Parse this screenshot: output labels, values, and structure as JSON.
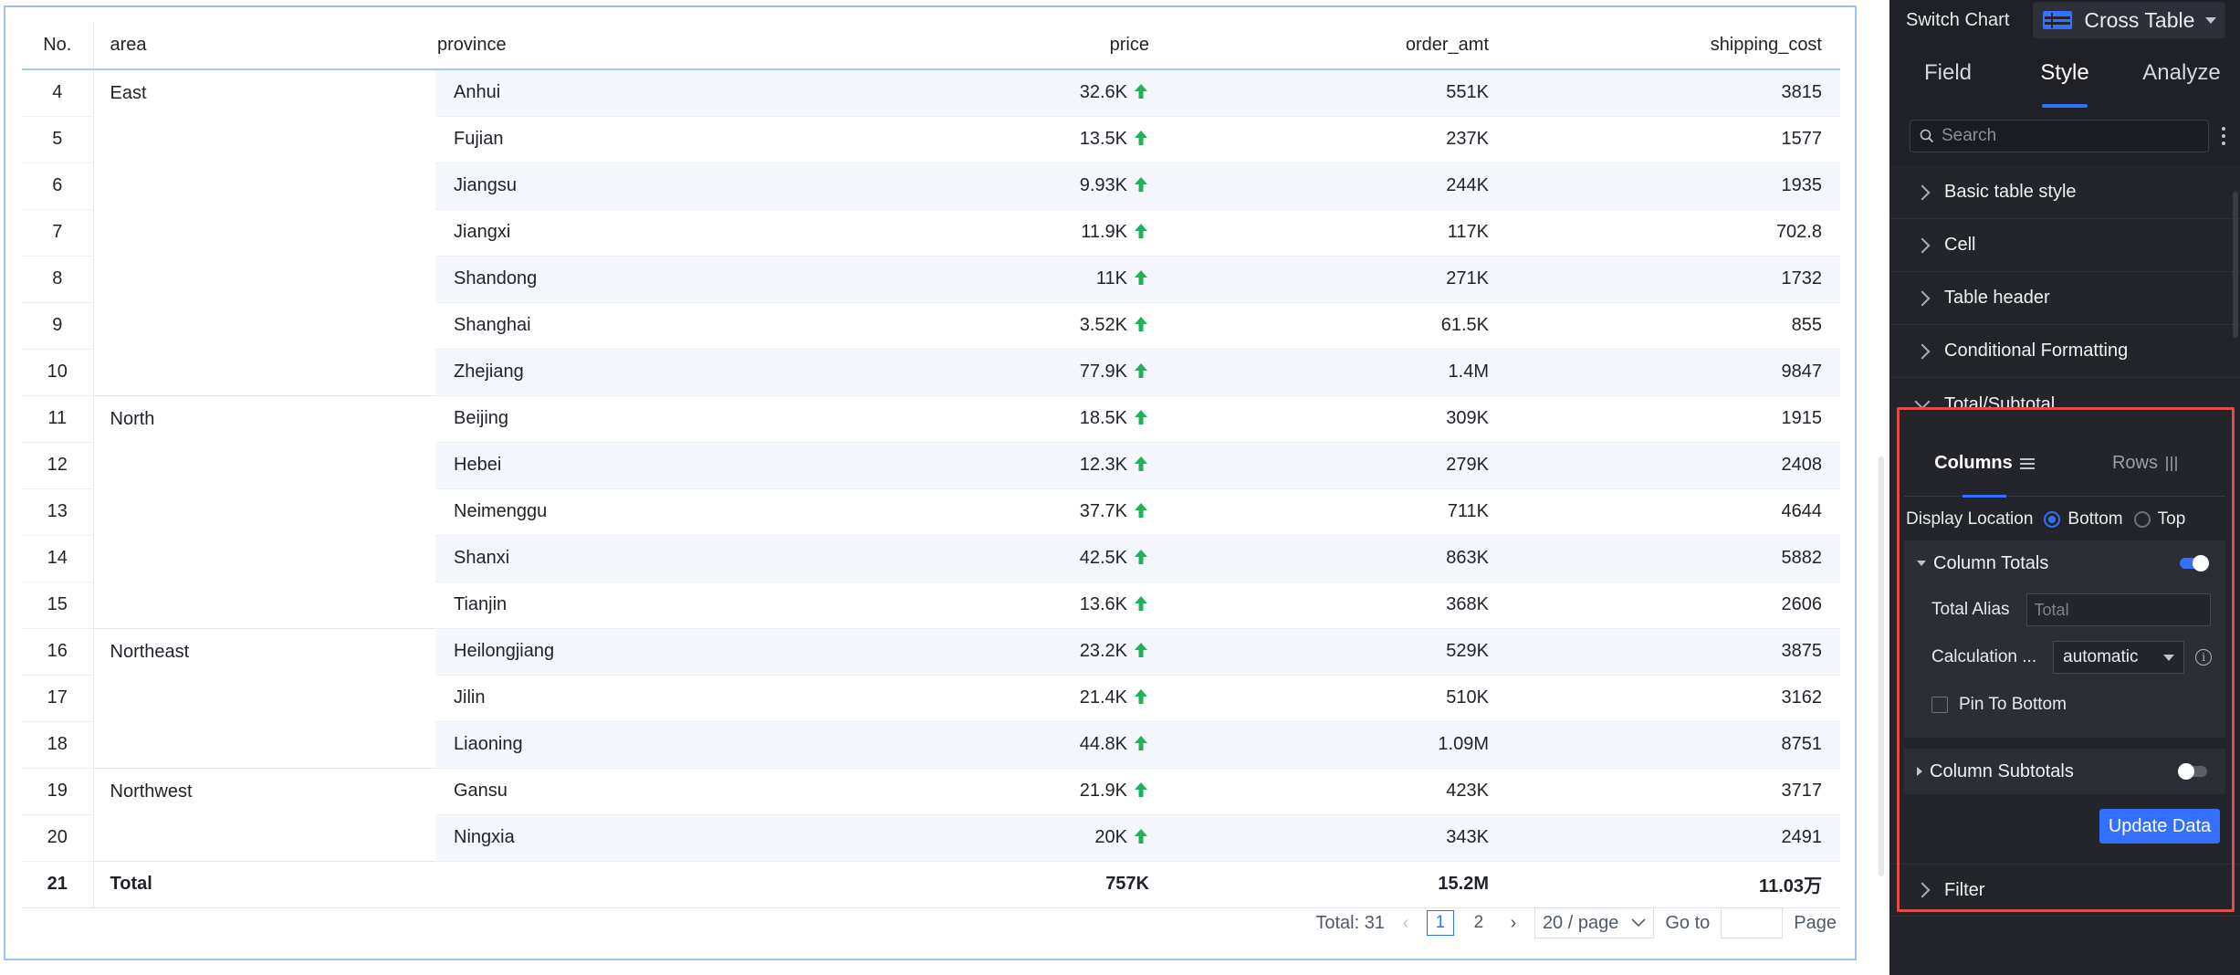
{
  "table": {
    "headers": [
      "No.",
      "area",
      "province",
      "price",
      "order_amt",
      "shipping_cost"
    ],
    "groups": [
      {
        "area": "East",
        "rows": [
          {
            "no": "4",
            "province": "Anhui",
            "price": "32.6K",
            "order_amt": "551K",
            "shipping_cost": "3815"
          },
          {
            "no": "5",
            "province": "Fujian",
            "price": "13.5K",
            "order_amt": "237K",
            "shipping_cost": "1577"
          },
          {
            "no": "6",
            "province": "Jiangsu",
            "price": "9.93K",
            "order_amt": "244K",
            "shipping_cost": "1935"
          },
          {
            "no": "7",
            "province": "Jiangxi",
            "price": "11.9K",
            "order_amt": "117K",
            "shipping_cost": "702.8"
          },
          {
            "no": "8",
            "province": "Shandong",
            "price": "11K",
            "order_amt": "271K",
            "shipping_cost": "1732"
          },
          {
            "no": "9",
            "province": "Shanghai",
            "price": "3.52K",
            "order_amt": "61.5K",
            "shipping_cost": "855"
          },
          {
            "no": "10",
            "province": "Zhejiang",
            "price": "77.9K",
            "order_amt": "1.4M",
            "shipping_cost": "9847"
          }
        ]
      },
      {
        "area": "North",
        "rows": [
          {
            "no": "11",
            "province": "Beijing",
            "price": "18.5K",
            "order_amt": "309K",
            "shipping_cost": "1915"
          },
          {
            "no": "12",
            "province": "Hebei",
            "price": "12.3K",
            "order_amt": "279K",
            "shipping_cost": "2408"
          },
          {
            "no": "13",
            "province": "Neimenggu",
            "price": "37.7K",
            "order_amt": "711K",
            "shipping_cost": "4644"
          },
          {
            "no": "14",
            "province": "Shanxi",
            "price": "42.5K",
            "order_amt": "863K",
            "shipping_cost": "5882"
          },
          {
            "no": "15",
            "province": "Tianjin",
            "price": "13.6K",
            "order_amt": "368K",
            "shipping_cost": "2606"
          }
        ]
      },
      {
        "area": "Northeast",
        "rows": [
          {
            "no": "16",
            "province": "Heilongjiang",
            "price": "23.2K",
            "order_amt": "529K",
            "shipping_cost": "3875"
          },
          {
            "no": "17",
            "province": "Jilin",
            "price": "21.4K",
            "order_amt": "510K",
            "shipping_cost": "3162"
          },
          {
            "no": "18",
            "province": "Liaoning",
            "price": "44.8K",
            "order_amt": "1.09M",
            "shipping_cost": "8751"
          }
        ]
      },
      {
        "area": "Northwest",
        "rows": [
          {
            "no": "19",
            "province": "Gansu",
            "price": "21.9K",
            "order_amt": "423K",
            "shipping_cost": "3717"
          },
          {
            "no": "20",
            "province": "Ningxia",
            "price": "20K",
            "order_amt": "343K",
            "shipping_cost": "2491"
          }
        ]
      }
    ],
    "total_row": {
      "no": "21",
      "label": "Total",
      "price": "757K",
      "order_amt": "15.2M",
      "shipping_cost": "11.03万"
    },
    "up_arrow_icon": "arrow-up-icon",
    "up_arrow_color": "#1fb25a"
  },
  "pagination": {
    "total": "Total: 31",
    "pages": [
      "1",
      "2"
    ],
    "current": "1",
    "page_size": "20 / page",
    "goto_label": "Go to",
    "page_label": "Page"
  },
  "panel": {
    "switch_chart_label": "Switch Chart",
    "chart_type": "Cross Table",
    "tabs": [
      "Field",
      "Style",
      "Analyze"
    ],
    "active_tab": "Style",
    "search_placeholder": "Search",
    "sections": [
      "Basic table style",
      "Cell",
      "Table header",
      "Conditional Formatting"
    ],
    "total_subtotal": {
      "title": "Total/Subtotal",
      "subtabs": [
        "Columns",
        "Rows"
      ],
      "active_subtab": "Columns",
      "display_location_label": "Display Location",
      "location_options": [
        "Bottom",
        "Top"
      ],
      "location_selected": "Bottom",
      "column_totals": {
        "title": "Column Totals",
        "enabled": true,
        "total_alias_label": "Total Alias",
        "total_alias_placeholder": "Total",
        "calc_label": "Calculation ...",
        "calc_value": "automatic",
        "pin_label": "Pin To Bottom",
        "pin_checked": false
      },
      "column_subtotals": {
        "title": "Column Subtotals",
        "enabled": false
      },
      "update_button": "Update Data"
    },
    "filter_section": "Filter",
    "accent_color": "#3370ff",
    "highlight_color": "#e04b4b"
  }
}
